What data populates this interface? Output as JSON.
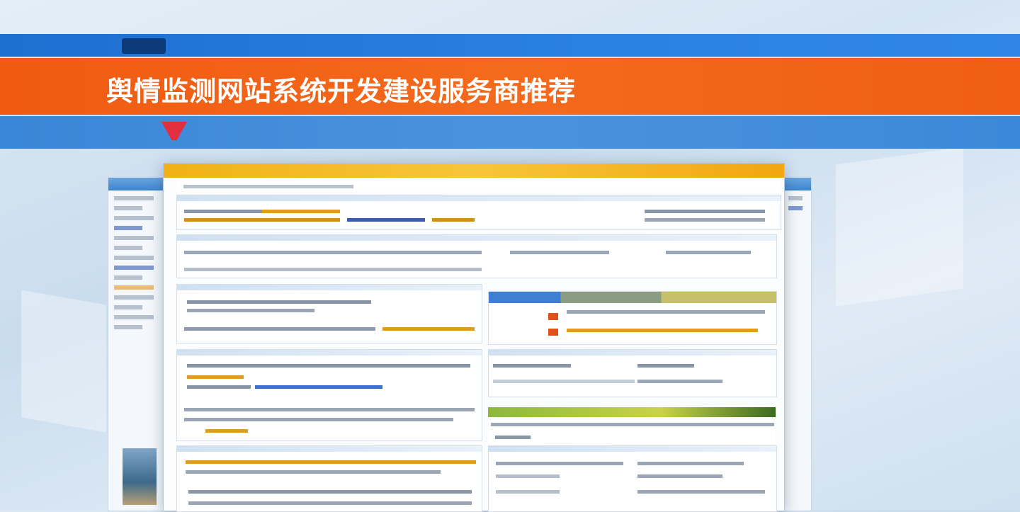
{
  "top_strip": {
    "logo_text": "",
    "color": "#1d6fd0"
  },
  "headline_band": {
    "color": "#f05a12",
    "headline": "舆情监测网站系统开发建设服务商推荐"
  },
  "info_band": {
    "color": "#3a86d6",
    "left_text": "",
    "mid_text": "",
    "right_text": ""
  },
  "main_window": {
    "title_left": "",
    "title_center": "",
    "accent_color": "#f1b116"
  }
}
